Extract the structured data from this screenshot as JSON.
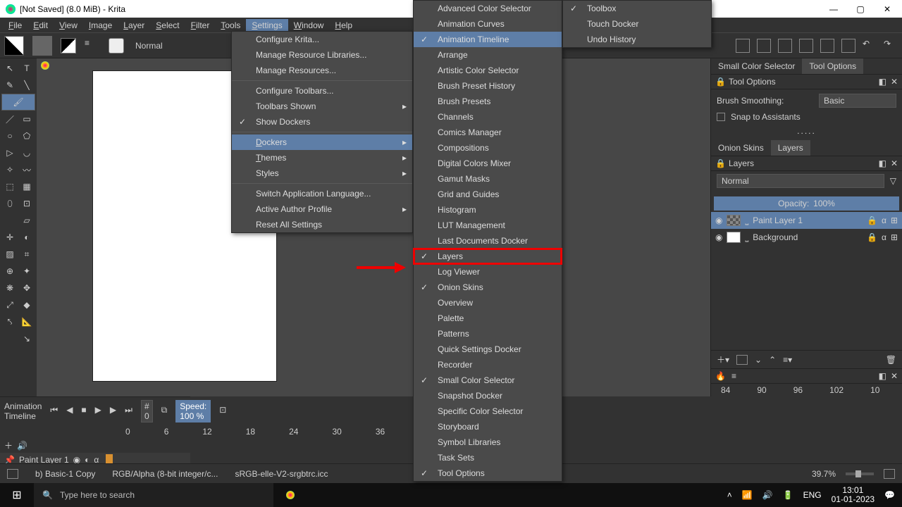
{
  "window": {
    "title": "[Not Saved]  (8.0 MiB)  - Krita"
  },
  "menubar": [
    "File",
    "Edit",
    "View",
    "Image",
    "Layer",
    "Select",
    "Filter",
    "Tools",
    "Settings",
    "Window",
    "Help"
  ],
  "activeMenu": "Settings",
  "toolbar": {
    "blend": "Normal"
  },
  "settingsMenu": [
    {
      "label": "Configure Krita..."
    },
    {
      "label": "Manage Resource Libraries..."
    },
    {
      "label": "Manage Resources..."
    },
    {
      "label": "Configure Toolbars..."
    },
    {
      "label": "Toolbars Shown",
      "sub": true
    },
    {
      "label": "Show Dockers",
      "chk": true
    },
    {
      "label": "Dockers",
      "sub": true,
      "hl": true,
      "u": "D"
    },
    {
      "label": "Themes",
      "sub": true,
      "u": "T"
    },
    {
      "label": "Styles",
      "sub": true
    },
    {
      "label": "Switch Application Language..."
    },
    {
      "label": "Active Author Profile",
      "sub": true
    },
    {
      "label": "Reset All Settings"
    }
  ],
  "dockersMenu": [
    {
      "label": "Advanced Color Selector"
    },
    {
      "label": "Animation Curves"
    },
    {
      "label": "Animation Timeline",
      "chk": true,
      "hl": true
    },
    {
      "label": "Arrange"
    },
    {
      "label": "Artistic Color Selector"
    },
    {
      "label": "Brush Preset History"
    },
    {
      "label": "Brush Presets"
    },
    {
      "label": "Channels"
    },
    {
      "label": "Comics Manager"
    },
    {
      "label": "Compositions"
    },
    {
      "label": "Digital Colors Mixer"
    },
    {
      "label": "Gamut Masks"
    },
    {
      "label": "Grid and Guides"
    },
    {
      "label": "Histogram"
    },
    {
      "label": "LUT Management"
    },
    {
      "label": "Last Documents Docker"
    },
    {
      "label": "Layers",
      "chk": true,
      "boxed": true
    },
    {
      "label": "Log Viewer"
    },
    {
      "label": "Onion Skins",
      "chk": true
    },
    {
      "label": "Overview"
    },
    {
      "label": "Palette"
    },
    {
      "label": "Patterns"
    },
    {
      "label": "Quick Settings Docker"
    },
    {
      "label": "Recorder"
    },
    {
      "label": "Small Color Selector",
      "chk": true
    },
    {
      "label": "Snapshot Docker"
    },
    {
      "label": "Specific Color Selector"
    },
    {
      "label": "Storyboard"
    },
    {
      "label": "Symbol Libraries"
    },
    {
      "label": "Task Sets"
    },
    {
      "label": "Tool Options",
      "chk": true
    }
  ],
  "dockersMenu2": [
    {
      "label": "Toolbox",
      "chk": true
    },
    {
      "label": "Touch Docker"
    },
    {
      "label": "Undo History"
    }
  ],
  "toolOptions": {
    "tabs": [
      "Small Color Selector",
      "Tool Options"
    ],
    "title": "Tool Options",
    "smoothLabel": "Brush Smoothing:",
    "smoothValue": "Basic",
    "assist": "Snap to Assistants",
    "dots": "....."
  },
  "layers": {
    "tabs": [
      "Onion Skins",
      "Layers"
    ],
    "title": "Layers",
    "blend": "Normal",
    "opacityLabel": "Opacity:",
    "opacityValue": "100%",
    "items": [
      {
        "name": "Paint Layer 1",
        "sel": true
      },
      {
        "name": "Background"
      }
    ],
    "timelineTicks": [
      "84",
      "90",
      "96",
      "102",
      "10"
    ]
  },
  "timeline": {
    "title": "Animation Timeline",
    "frame": "# 0",
    "speedLabel": "Speed:",
    "speedValue": "100 %",
    "ticks": [
      "0",
      "6",
      "12",
      "18",
      "24",
      "30",
      "36"
    ],
    "layer": "Paint Layer 1"
  },
  "status": {
    "brush": "b) Basic-1 Copy",
    "colorspace": "RGB/Alpha (8-bit integer/c...",
    "profile": "sRGB-elle-V2-srgbtrc.icc",
    "zoom": "39.7%"
  },
  "taskbar": {
    "search": "Type here to search",
    "lang": "ENG",
    "time": "13:01",
    "date": "01-01-2023"
  }
}
